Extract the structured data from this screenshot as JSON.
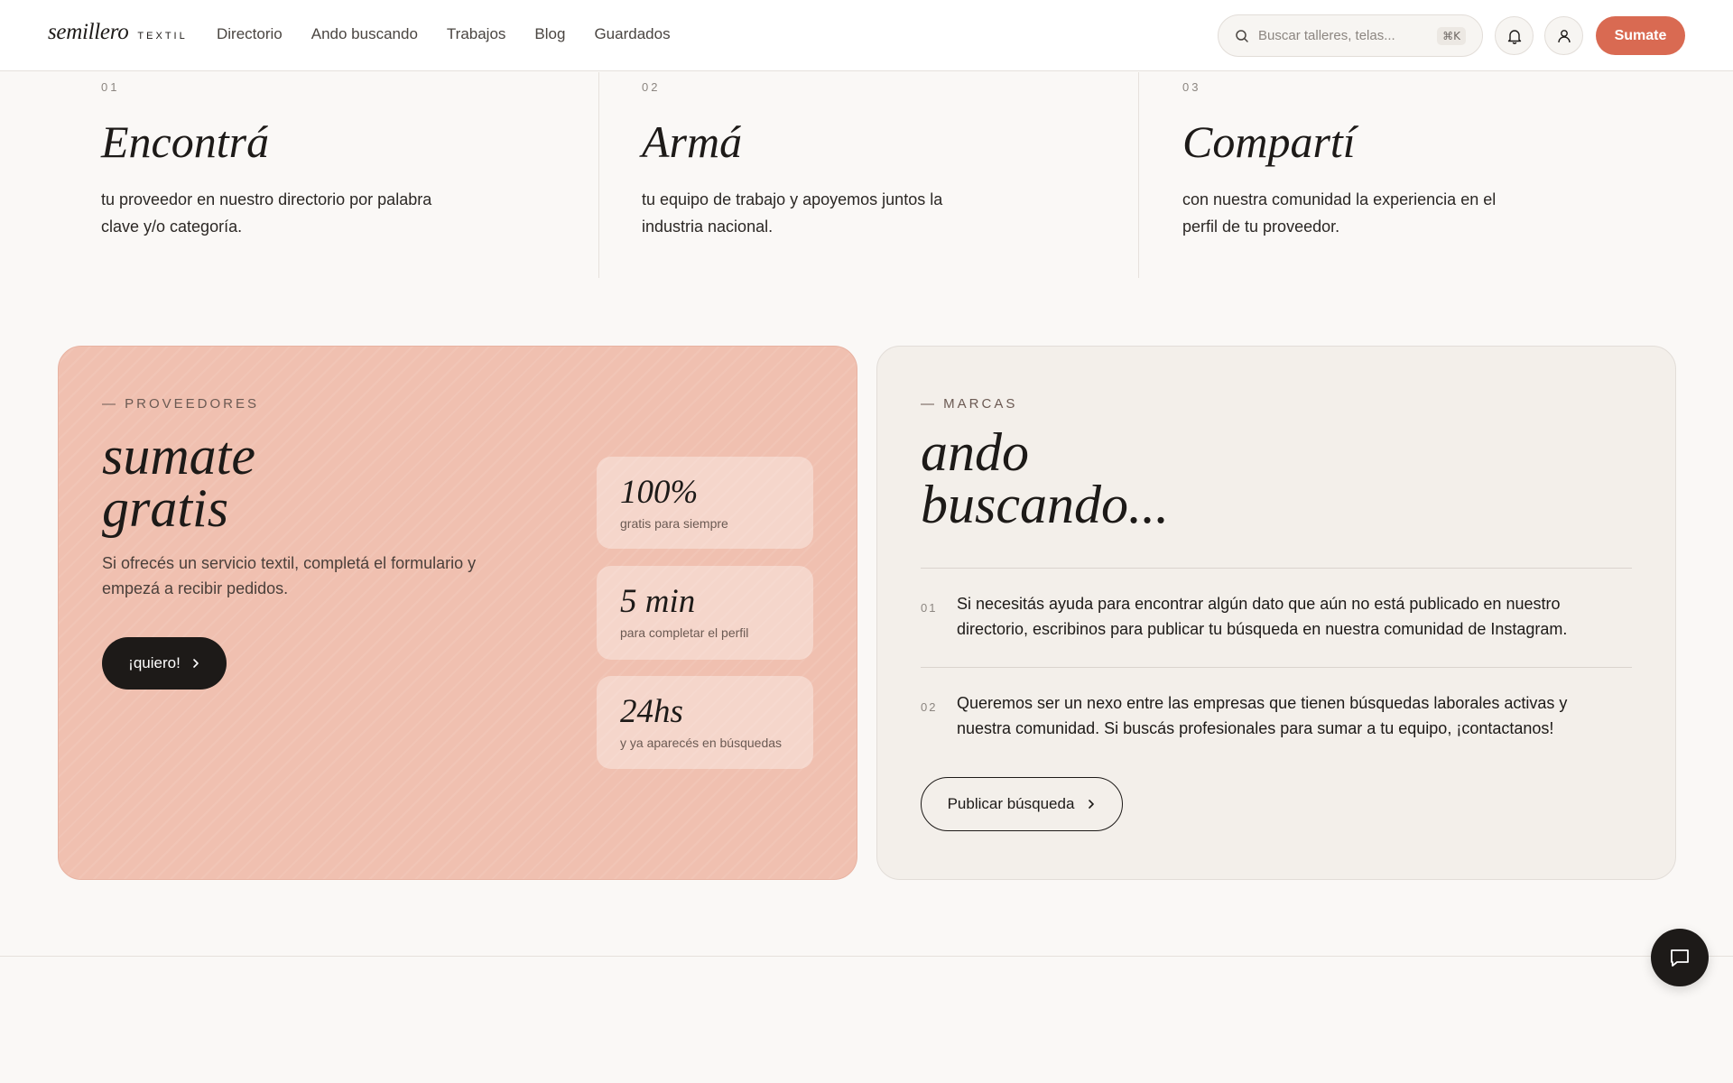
{
  "header": {
    "logo_word": "semillero",
    "logo_sub": "TEXTIL",
    "nav": [
      "Directorio",
      "Ando buscando",
      "Trabajos",
      "Blog",
      "Guardados"
    ],
    "search_placeholder": "Buscar talleres, telas...",
    "search_shortcut": "⌘K",
    "cta_label": "Sumate",
    "icons": [
      "search-icon",
      "bell-icon",
      "user-icon"
    ]
  },
  "steps": [
    {
      "num": "01",
      "title": "Encontrá",
      "desc": "tu proveedor en nuestro directorio por palabra clave y/o categoría."
    },
    {
      "num": "02",
      "title": "Armá",
      "desc": "tu equipo de trabajo y apoyemos juntos la industria nacional."
    },
    {
      "num": "03",
      "title": "Compartí",
      "desc": "con nuestra comunidad la experiencia en el perfil de tu proveedor."
    }
  ],
  "providers": {
    "eyebrow": "— PROVEEDORES",
    "title_line1": "sumate",
    "title_line2": "gratis",
    "desc": "Si ofrecés un servicio textil, completá el formulario y empezá a recibir pedidos.",
    "button_label": "¡quiero!",
    "stats": [
      {
        "value": "100%",
        "label": "gratis para siempre"
      },
      {
        "value": "5 min",
        "label": "para completar el perfil"
      },
      {
        "value": "24hs",
        "label": "y ya aparecés en búsquedas"
      }
    ],
    "bg_color": "#f0c0b0"
  },
  "brands": {
    "eyebrow": "— MARCAS",
    "title_line1": "ando",
    "title_line2": "buscando...",
    "items": [
      {
        "num": "01",
        "text": "Si necesitás ayuda para encontrar algún dato que aún no está publicado en nuestro directorio, escribinos para publicar tu búsqueda en nuestra comunidad de Instagram."
      },
      {
        "num": "02",
        "text": "Queremos ser un nexo entre las empresas que tienen búsquedas laborales activas y nuestra comunidad. Si buscás profesionales para sumar a tu equipo, ¡contactanos!"
      }
    ],
    "button_label": "Publicar búsqueda"
  },
  "colors": {
    "accent": "#d96a52",
    "dark": "#1d1a18",
    "background": "#faf8f6"
  },
  "chat_icon": "chat-bubble-icon"
}
